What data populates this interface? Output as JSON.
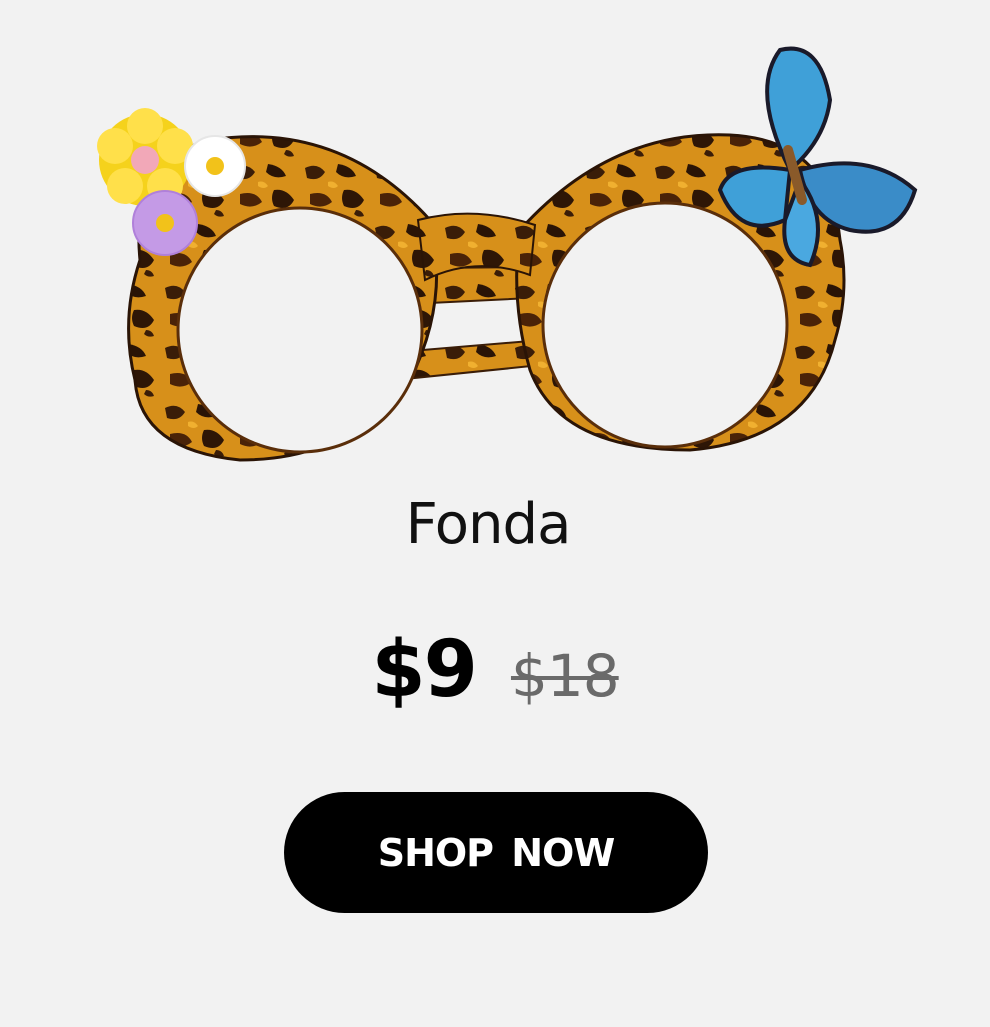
{
  "product": {
    "name": "Fonda",
    "sale_price": "$9",
    "original_price": "$18"
  },
  "cta": {
    "label": "SHOP NOW"
  },
  "colors": {
    "background": "#f2f2f2",
    "button": "#000000",
    "button_text": "#ffffff",
    "sale_price": "#000000",
    "original_price": "#6a6a6a"
  },
  "image": {
    "subject": "tortoiseshell-cat-eye-glasses-with-flowers-and-butterfly"
  }
}
